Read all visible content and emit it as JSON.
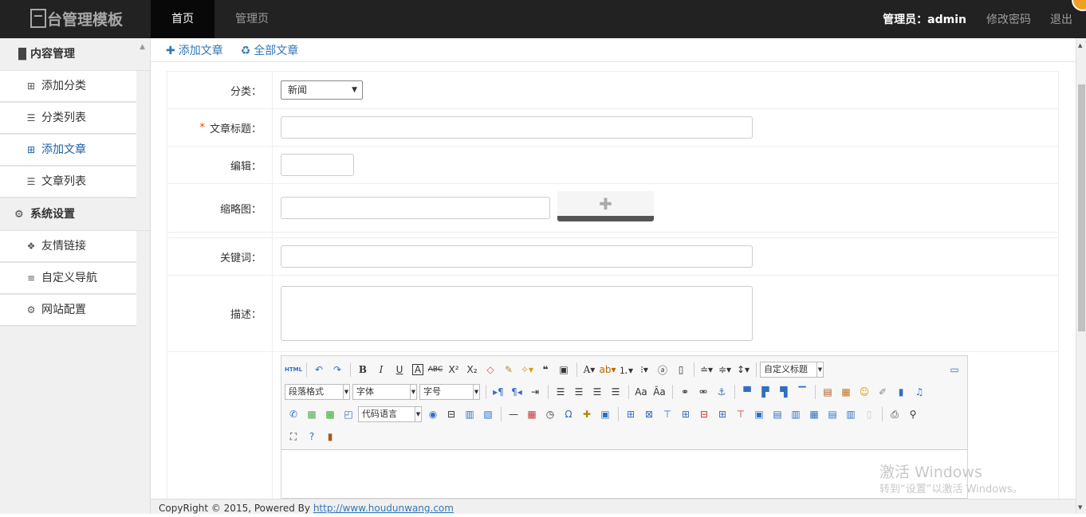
{
  "header": {
    "logo": "台管理模板",
    "nav": [
      "首页",
      "管理页"
    ],
    "admin": "管理员：admin",
    "change_password": "修改密码",
    "logout": "退出"
  },
  "sidebar": {
    "sections": [
      {
        "title": "内容管理",
        "icon": "document-copy-icon",
        "items": [
          {
            "label": "添加分类",
            "icon": "plus-square-icon"
          },
          {
            "label": "分类列表",
            "icon": "list-icon"
          },
          {
            "label": "添加文章",
            "icon": "plus-square-icon",
            "active": true
          },
          {
            "label": "文章列表",
            "icon": "list-icon"
          }
        ]
      },
      {
        "title": "系统设置",
        "icon": "gear-icon",
        "items": [
          {
            "label": "友情链接",
            "icon": "cubes-icon"
          },
          {
            "label": "自定义导航",
            "icon": "bars-icon"
          },
          {
            "label": "网站配置",
            "icon": "cogs-icon"
          }
        ]
      }
    ]
  },
  "tabs": [
    {
      "label": "添加文章",
      "icon": "plus-icon"
    },
    {
      "label": "全部文章",
      "icon": "recycle-icon"
    }
  ],
  "form": {
    "category_label": "分类：",
    "category_value": "新闻",
    "title_label": "文章标题：",
    "required_mark": "*",
    "editor_label": "编辑：",
    "thumb_label": "缩略图：",
    "keywords_label": "关键词：",
    "description_label": "描述："
  },
  "editor": {
    "custom_title": "自定义标题",
    "paragraph": "段落格式",
    "font": "字体",
    "size": "字号",
    "code_lang": "代码语言"
  },
  "footer": {
    "text": "CopyRight © 2015, Powered By ",
    "link": "http://www.houdunwang.com"
  },
  "watermark": {
    "line1": "激活 Windows",
    "line2": "转到“设置”以激活 Windows。"
  },
  "colors": {
    "topbar": "#222222",
    "link_blue": "#3277b8",
    "required": "#e04a00"
  }
}
